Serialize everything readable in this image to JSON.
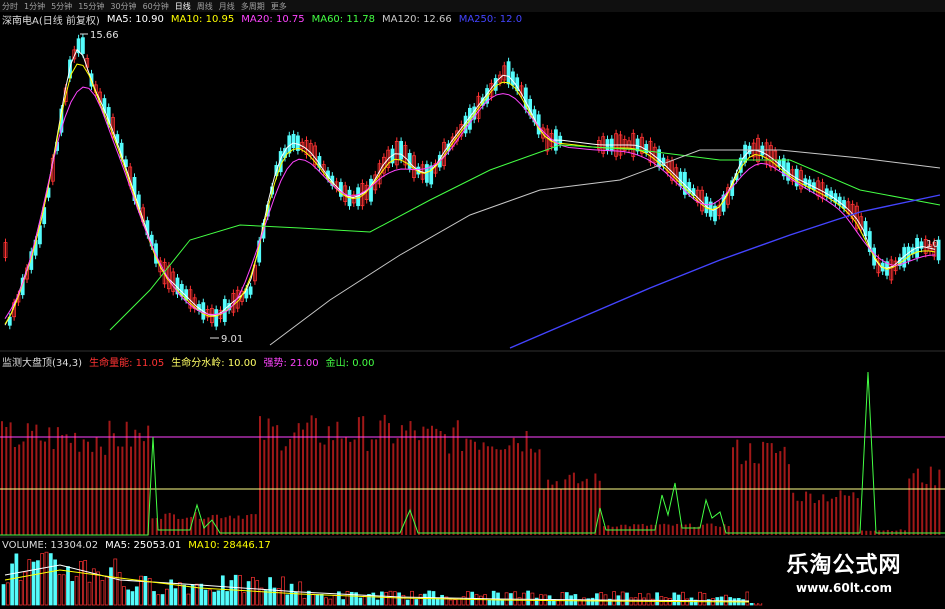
{
  "toolbar": {
    "items": [
      "分时",
      "1分钟",
      "5分钟",
      "15分钟",
      "30分钟",
      "60分钟",
      "日线",
      "周线",
      "月线",
      "多周期",
      "更多"
    ],
    "active_index": 6
  },
  "main_panel": {
    "title": "深南电A(日线 前复权)",
    "ma": [
      {
        "label": "MA5: 10.90",
        "color": "#ffffff"
      },
      {
        "label": "MA10: 10.95",
        "color": "#ffff00"
      },
      {
        "label": "MA20: 10.75",
        "color": "#ff44ff"
      },
      {
        "label": "MA60: 11.78",
        "color": "#44ff44"
      },
      {
        "label": "MA120: 12.66",
        "color": "#c8c8c8"
      },
      {
        "label": "MA250: 12.0",
        "color": "#4444ff"
      }
    ],
    "high_label": "15.66",
    "low_label": "9.01",
    "right_label": "10"
  },
  "indicator_panel": {
    "title": "监测大盘顶(34,3)",
    "items": [
      {
        "label": "生命量能: 11.05",
        "color": "#ff3333"
      },
      {
        "label": "生命分水岭: 10.00",
        "color": "#ffff66"
      },
      {
        "label": "强势: 21.00",
        "color": "#ff44ff"
      },
      {
        "label": "金山: 0.00",
        "color": "#44ff44"
      }
    ]
  },
  "volume_panel": {
    "title": "VOLUME: 13304.02",
    "items": [
      {
        "label": "MA5: 25053.01",
        "color": "#ffffff"
      },
      {
        "label": "MA10: 28446.17",
        "color": "#ffff00"
      }
    ]
  },
  "watermark": {
    "title": "乐淘公式网",
    "url": "www.60lt.com"
  },
  "colors": {
    "up": "#ff3333",
    "down": "#54fcfc",
    "ma5": "#ffffff",
    "ma10": "#ffff00",
    "ma20": "#ff44ff",
    "ma60": "#44ff44",
    "ma120": "#c8c8c8",
    "ma250": "#4444ff",
    "bars": "#a01818"
  }
}
